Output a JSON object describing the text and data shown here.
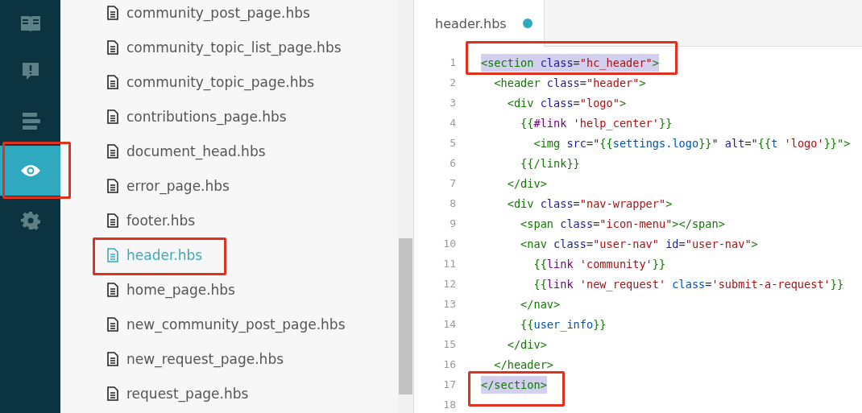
{
  "sidebar": {
    "items": [
      {
        "kind": "book",
        "selected": false,
        "annotated": false
      },
      {
        "kind": "alert",
        "selected": false,
        "annotated": false
      },
      {
        "kind": "list",
        "selected": false,
        "annotated": false
      },
      {
        "kind": "eye",
        "selected": true,
        "annotated": true
      },
      {
        "kind": "gear",
        "selected": false,
        "annotated": false
      }
    ]
  },
  "files": [
    {
      "name": "community_post_page.hbs",
      "selected": false,
      "annotated": false
    },
    {
      "name": "community_topic_list_page.hbs",
      "selected": false,
      "annotated": false
    },
    {
      "name": "community_topic_page.hbs",
      "selected": false,
      "annotated": false
    },
    {
      "name": "contributions_page.hbs",
      "selected": false,
      "annotated": false
    },
    {
      "name": "document_head.hbs",
      "selected": false,
      "annotated": false
    },
    {
      "name": "error_page.hbs",
      "selected": false,
      "annotated": false
    },
    {
      "name": "footer.hbs",
      "selected": false,
      "annotated": false
    },
    {
      "name": "header.hbs",
      "selected": true,
      "annotated": true
    },
    {
      "name": "home_page.hbs",
      "selected": false,
      "annotated": false
    },
    {
      "name": "new_community_post_page.hbs",
      "selected": false,
      "annotated": false
    },
    {
      "name": "new_request_page.hbs",
      "selected": false,
      "annotated": false
    },
    {
      "name": "request_page.hbs",
      "selected": false,
      "annotated": false
    }
  ],
  "editor": {
    "tab": {
      "title": "header.hbs",
      "modified": true
    },
    "lines": [
      {
        "number": "1",
        "matched": true,
        "annotated": true,
        "tokens": [
          {
            "text": "<section",
            "kind": "tag"
          },
          {
            "text": " class",
            "kind": "attr"
          },
          {
            "text": "=",
            "kind": "plain"
          },
          {
            "text": "\"hc_header\"",
            "kind": "string"
          },
          {
            "text": ">",
            "kind": "tag"
          }
        ]
      },
      {
        "number": "2",
        "matched": false,
        "annotated": false,
        "tokens": [
          {
            "text": "  <header",
            "kind": "tag"
          },
          {
            "text": " class",
            "kind": "attr"
          },
          {
            "text": "=",
            "kind": "plain"
          },
          {
            "text": "\"header\"",
            "kind": "string"
          },
          {
            "text": ">",
            "kind": "tag"
          }
        ]
      },
      {
        "number": "3",
        "matched": false,
        "annotated": false,
        "tokens": [
          {
            "text": "    <div",
            "kind": "tag"
          },
          {
            "text": " class",
            "kind": "attr"
          },
          {
            "text": "=",
            "kind": "plain"
          },
          {
            "text": "\"logo\"",
            "kind": "string"
          },
          {
            "text": ">",
            "kind": "tag"
          }
        ]
      },
      {
        "number": "4",
        "matched": false,
        "annotated": false,
        "tokens": [
          {
            "text": "      {{",
            "kind": "tag"
          },
          {
            "text": "#link",
            "kind": "keyword"
          },
          {
            "text": " 'help_center'",
            "kind": "string"
          },
          {
            "text": "}}",
            "kind": "tag"
          }
        ]
      },
      {
        "number": "5",
        "matched": false,
        "annotated": false,
        "tokens": [
          {
            "text": "        <img",
            "kind": "tag"
          },
          {
            "text": " src",
            "kind": "attr"
          },
          {
            "text": "=\"",
            "kind": "plain"
          },
          {
            "text": "{{",
            "kind": "tag"
          },
          {
            "text": "settings.logo",
            "kind": "variable"
          },
          {
            "text": "}}",
            "kind": "tag"
          },
          {
            "text": "\"",
            "kind": "plain"
          },
          {
            "text": " alt",
            "kind": "attr"
          },
          {
            "text": "=\"",
            "kind": "plain"
          },
          {
            "text": "{{",
            "kind": "tag"
          },
          {
            "text": "t",
            "kind": "variable"
          },
          {
            "text": " 'logo'",
            "kind": "string"
          },
          {
            "text": "}}",
            "kind": "tag"
          },
          {
            "text": "\">",
            "kind": "tag"
          }
        ]
      },
      {
        "number": "6",
        "matched": false,
        "annotated": false,
        "tokens": [
          {
            "text": "      {{/link}}",
            "kind": "tag"
          }
        ]
      },
      {
        "number": "7",
        "matched": false,
        "annotated": false,
        "tokens": [
          {
            "text": "    </div>",
            "kind": "tag"
          }
        ]
      },
      {
        "number": "8",
        "matched": false,
        "annotated": false,
        "tokens": [
          {
            "text": "    <div",
            "kind": "tag"
          },
          {
            "text": " class",
            "kind": "attr"
          },
          {
            "text": "=",
            "kind": "plain"
          },
          {
            "text": "\"nav-wrapper\"",
            "kind": "string"
          },
          {
            "text": ">",
            "kind": "tag"
          }
        ]
      },
      {
        "number": "9",
        "matched": false,
        "annotated": false,
        "tokens": [
          {
            "text": "      <span",
            "kind": "tag"
          },
          {
            "text": " class",
            "kind": "attr"
          },
          {
            "text": "=",
            "kind": "plain"
          },
          {
            "text": "\"icon-menu\"",
            "kind": "string"
          },
          {
            "text": "></span>",
            "kind": "tag"
          }
        ]
      },
      {
        "number": "10",
        "matched": false,
        "annotated": false,
        "tokens": [
          {
            "text": "      <nav",
            "kind": "tag"
          },
          {
            "text": " class",
            "kind": "attr"
          },
          {
            "text": "=",
            "kind": "plain"
          },
          {
            "text": "\"user-nav\"",
            "kind": "string"
          },
          {
            "text": " id",
            "kind": "attr"
          },
          {
            "text": "=",
            "kind": "plain"
          },
          {
            "text": "\"user-nav\"",
            "kind": "string"
          },
          {
            "text": ">",
            "kind": "tag"
          }
        ]
      },
      {
        "number": "11",
        "matched": false,
        "annotated": false,
        "tokens": [
          {
            "text": "        {{",
            "kind": "tag"
          },
          {
            "text": "link",
            "kind": "keyword"
          },
          {
            "text": " 'community'",
            "kind": "string"
          },
          {
            "text": "}}",
            "kind": "tag"
          }
        ]
      },
      {
        "number": "12",
        "matched": false,
        "annotated": false,
        "tokens": [
          {
            "text": "        {{",
            "kind": "tag"
          },
          {
            "text": "link",
            "kind": "keyword"
          },
          {
            "text": " 'new_request'",
            "kind": "string"
          },
          {
            "text": " class",
            "kind": "variable"
          },
          {
            "text": "=",
            "kind": "plain"
          },
          {
            "text": "'submit-a-request'",
            "kind": "string"
          },
          {
            "text": "}}",
            "kind": "tag"
          }
        ]
      },
      {
        "number": "13",
        "matched": false,
        "annotated": false,
        "tokens": [
          {
            "text": "      </nav>",
            "kind": "tag"
          }
        ]
      },
      {
        "number": "14",
        "matched": false,
        "annotated": false,
        "tokens": [
          {
            "text": "      {{",
            "kind": "tag"
          },
          {
            "text": "user_info",
            "kind": "variable"
          },
          {
            "text": "}}",
            "kind": "tag"
          }
        ]
      },
      {
        "number": "15",
        "matched": false,
        "annotated": false,
        "tokens": [
          {
            "text": "    </div>",
            "kind": "tag"
          }
        ]
      },
      {
        "number": "16",
        "matched": false,
        "annotated": false,
        "tokens": [
          {
            "text": "  </header>",
            "kind": "tag"
          }
        ]
      },
      {
        "number": "17",
        "matched": true,
        "annotated": true,
        "tokens": [
          {
            "text": "</section>",
            "kind": "tag"
          }
        ]
      },
      {
        "number": "18",
        "annotated": false
      }
    ]
  }
}
